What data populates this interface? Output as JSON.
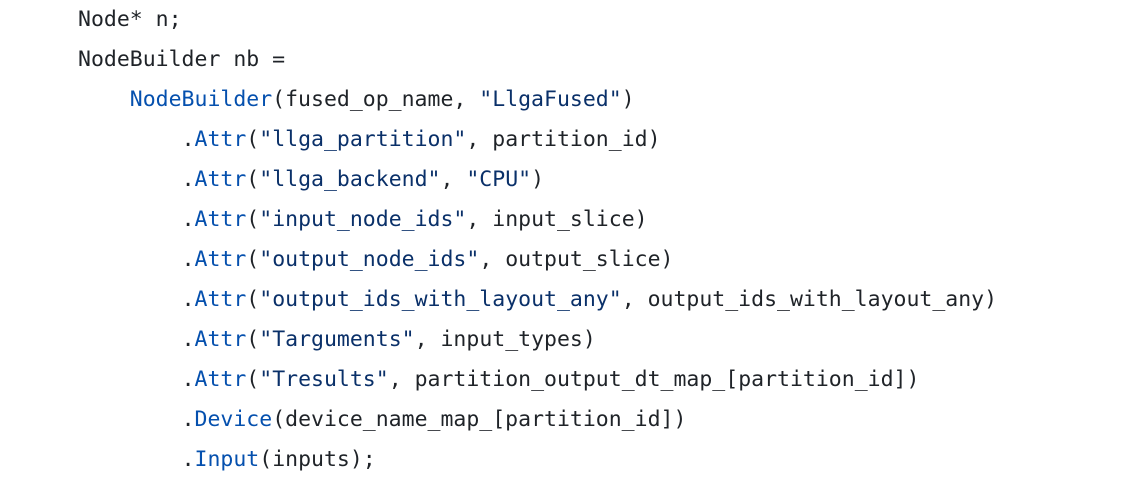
{
  "code": {
    "lines": [
      {
        "indent": "",
        "tokens": [
          {
            "t": "plain",
            "v": "Node* n;"
          }
        ]
      },
      {
        "indent": "",
        "tokens": [
          {
            "t": "plain",
            "v": "NodeBuilder nb ="
          }
        ]
      },
      {
        "indent": "    ",
        "tokens": [
          {
            "t": "fn",
            "v": "NodeBuilder"
          },
          {
            "t": "plain",
            "v": "(fused_op_name, "
          },
          {
            "t": "str",
            "v": "\"LlgaFused\""
          },
          {
            "t": "plain",
            "v": ")"
          }
        ]
      },
      {
        "indent": "        ",
        "tokens": [
          {
            "t": "plain",
            "v": "."
          },
          {
            "t": "fn",
            "v": "Attr"
          },
          {
            "t": "plain",
            "v": "("
          },
          {
            "t": "str",
            "v": "\"llga_partition\""
          },
          {
            "t": "plain",
            "v": ", partition_id)"
          }
        ]
      },
      {
        "indent": "        ",
        "tokens": [
          {
            "t": "plain",
            "v": "."
          },
          {
            "t": "fn",
            "v": "Attr"
          },
          {
            "t": "plain",
            "v": "("
          },
          {
            "t": "str",
            "v": "\"llga_backend\""
          },
          {
            "t": "plain",
            "v": ", "
          },
          {
            "t": "str",
            "v": "\"CPU\""
          },
          {
            "t": "plain",
            "v": ")"
          }
        ]
      },
      {
        "indent": "        ",
        "tokens": [
          {
            "t": "plain",
            "v": "."
          },
          {
            "t": "fn",
            "v": "Attr"
          },
          {
            "t": "plain",
            "v": "("
          },
          {
            "t": "str",
            "v": "\"input_node_ids\""
          },
          {
            "t": "plain",
            "v": ", input_slice)"
          }
        ]
      },
      {
        "indent": "        ",
        "tokens": [
          {
            "t": "plain",
            "v": "."
          },
          {
            "t": "fn",
            "v": "Attr"
          },
          {
            "t": "plain",
            "v": "("
          },
          {
            "t": "str",
            "v": "\"output_node_ids\""
          },
          {
            "t": "plain",
            "v": ", output_slice)"
          }
        ]
      },
      {
        "indent": "        ",
        "tokens": [
          {
            "t": "plain",
            "v": "."
          },
          {
            "t": "fn",
            "v": "Attr"
          },
          {
            "t": "plain",
            "v": "("
          },
          {
            "t": "str",
            "v": "\"output_ids_with_layout_any\""
          },
          {
            "t": "plain",
            "v": ", output_ids_with_layout_any)"
          }
        ]
      },
      {
        "indent": "        ",
        "tokens": [
          {
            "t": "plain",
            "v": "."
          },
          {
            "t": "fn",
            "v": "Attr"
          },
          {
            "t": "plain",
            "v": "("
          },
          {
            "t": "str",
            "v": "\"Targuments\""
          },
          {
            "t": "plain",
            "v": ", input_types)"
          }
        ]
      },
      {
        "indent": "        ",
        "tokens": [
          {
            "t": "plain",
            "v": "."
          },
          {
            "t": "fn",
            "v": "Attr"
          },
          {
            "t": "plain",
            "v": "("
          },
          {
            "t": "str",
            "v": "\"Tresults\""
          },
          {
            "t": "plain",
            "v": ", partition_output_dt_map_[partition_id])"
          }
        ]
      },
      {
        "indent": "        ",
        "tokens": [
          {
            "t": "plain",
            "v": "."
          },
          {
            "t": "fn",
            "v": "Device"
          },
          {
            "t": "plain",
            "v": "(device_name_map_[partition_id])"
          }
        ]
      },
      {
        "indent": "        ",
        "tokens": [
          {
            "t": "plain",
            "v": "."
          },
          {
            "t": "fn",
            "v": "Input"
          },
          {
            "t": "plain",
            "v": "(inputs);"
          }
        ]
      }
    ]
  },
  "colors": {
    "background": "#ffffff",
    "plain_text": "#1f2328",
    "function_name": "#0550ae",
    "string_literal": "#0a3069"
  }
}
